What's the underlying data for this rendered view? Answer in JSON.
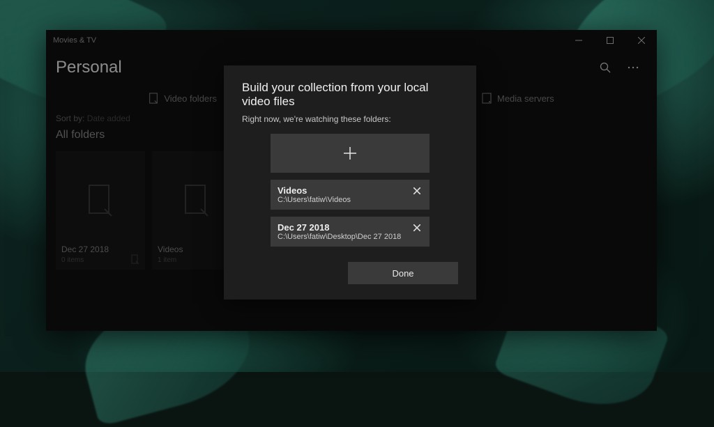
{
  "app": {
    "title": "Movies & TV"
  },
  "header": {
    "page_title": "Personal"
  },
  "tabs": [
    {
      "label": "Video folders",
      "icon": "folder-outline-icon"
    },
    {
      "label": "Media servers",
      "icon": "server-icon"
    }
  ],
  "sort": {
    "label": "Sort by:",
    "value": "Date added"
  },
  "section": {
    "title": "All folders"
  },
  "folders": [
    {
      "name": "Dec 27 2018",
      "sub": "0 items"
    },
    {
      "name": "Videos",
      "sub": "1 item"
    }
  ],
  "dialog": {
    "title": "Build your collection from your local video files",
    "subtitle": "Right now, we're watching these folders:",
    "items": [
      {
        "name": "Videos",
        "path": "C:\\Users\\fatiw\\Videos"
      },
      {
        "name": "Dec 27 2018",
        "path": "C:\\Users\\fatiw\\Desktop\\Dec 27 2018"
      }
    ],
    "done": "Done"
  }
}
